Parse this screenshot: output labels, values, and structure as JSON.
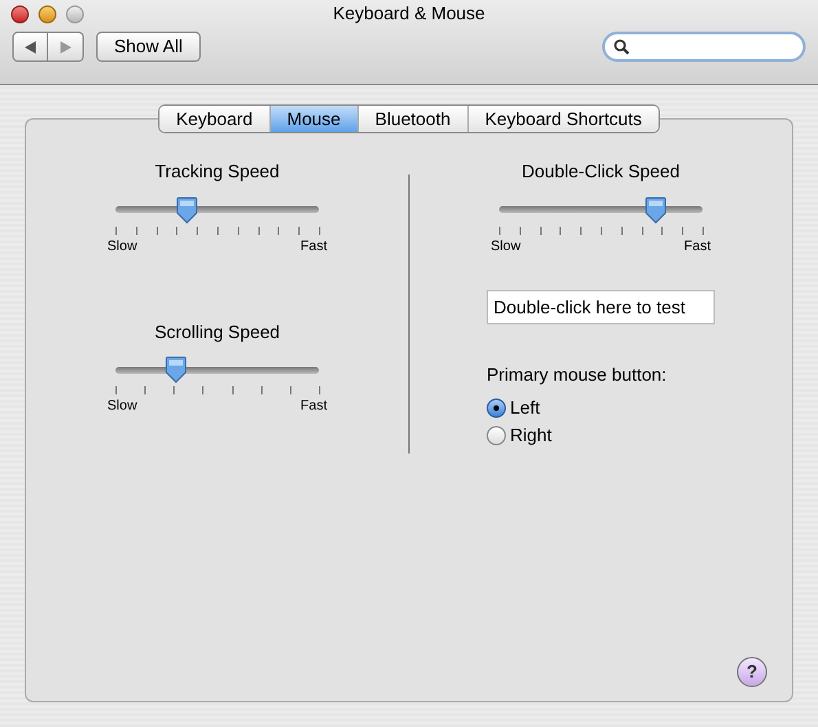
{
  "window": {
    "title": "Keyboard & Mouse"
  },
  "toolbar": {
    "show_all": "Show All"
  },
  "tabs": [
    {
      "label": "Keyboard",
      "selected": false
    },
    {
      "label": "Mouse",
      "selected": true
    },
    {
      "label": "Bluetooth",
      "selected": false
    },
    {
      "label": "Keyboard Shortcuts",
      "selected": false
    }
  ],
  "left_sliders": [
    {
      "title": "Tracking Speed",
      "kind": "fine",
      "level": 0.35,
      "min_label": "Slow",
      "max_label": "Fast"
    },
    {
      "title": "Scrolling Speed",
      "kind": "coarse",
      "level": 0.3,
      "min_label": "Slow",
      "max_label": "Fast"
    }
  ],
  "double_click": {
    "title": "Double-Click Speed",
    "kind": "fine",
    "level": 0.77,
    "min_label": "Slow",
    "max_label": "Fast",
    "test_field": "Double-click here to test"
  },
  "primary_button": {
    "label": "Primary mouse button:",
    "options": [
      {
        "label": "Left",
        "selected": true
      },
      {
        "label": "Right",
        "selected": false
      }
    ]
  },
  "help": "?"
}
